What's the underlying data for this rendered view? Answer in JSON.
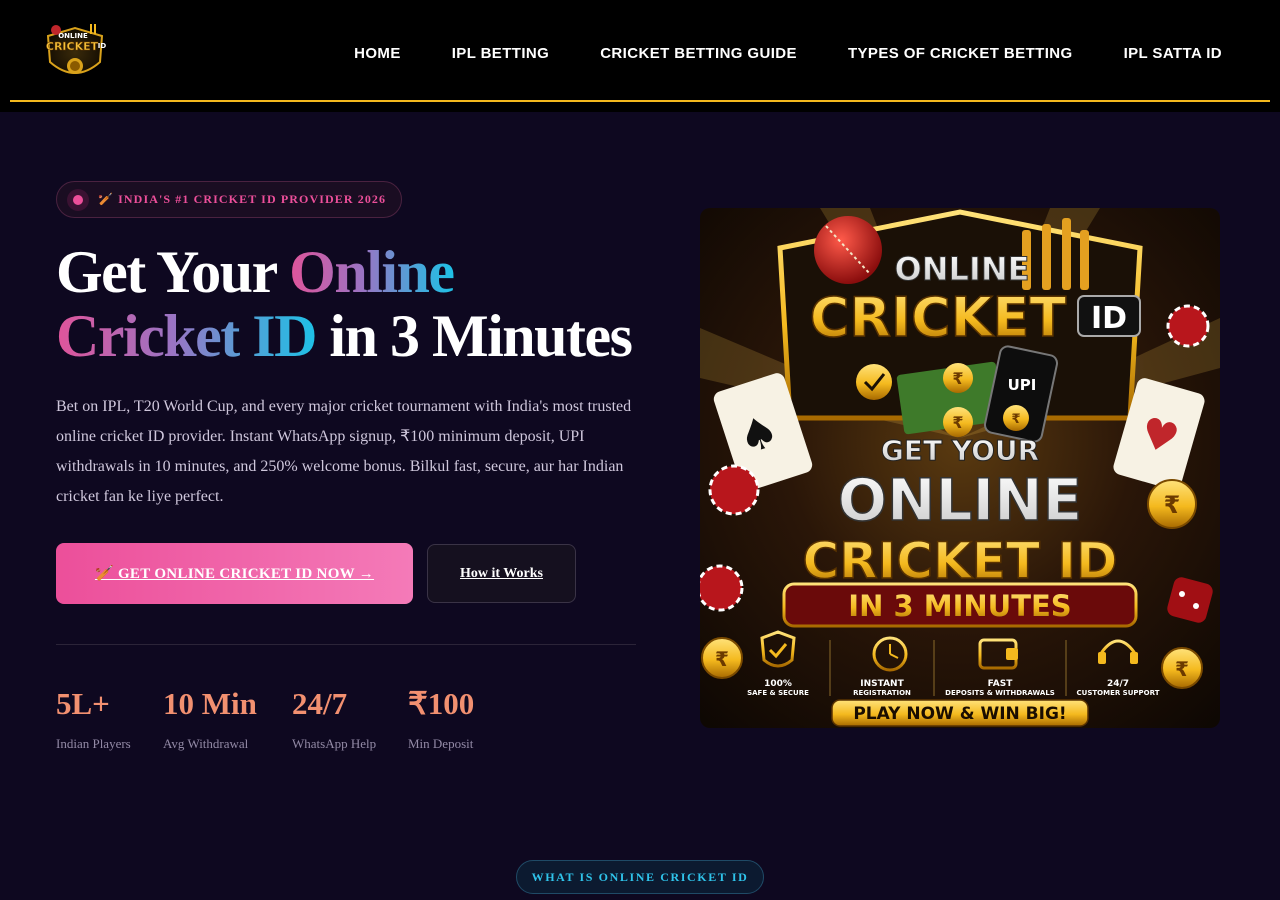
{
  "header": {
    "logo": {
      "line1": "ONLINE",
      "line2": "CRICKET",
      "line3": "ID"
    },
    "nav": [
      {
        "label": "HOME"
      },
      {
        "label": "IPL BETTING"
      },
      {
        "label": "CRICKET BETTING GUIDE"
      },
      {
        "label": "TYPES OF CRICKET BETTING"
      },
      {
        "label": "IPL SATTA ID"
      }
    ]
  },
  "hero": {
    "badge": "🏏 INDIA'S #1 CRICKET ID PROVIDER 2026",
    "headline": {
      "part1": "Get Your ",
      "grad1": "Online",
      "grad2": "Cricket ID",
      "part2": " in 3 Minutes"
    },
    "description": "Bet on IPL, T20 World Cup, and every major cricket tournament with India's most trusted online cricket ID provider. Instant WhatsApp signup, ₹100 minimum deposit, UPI withdrawals in 10 minutes, and 250% welcome bonus. Bilkul fast, secure, aur har Indian cricket fan ke liye perfect.",
    "primary_cta": "🏏 GET ONLINE CRICKET ID NOW →",
    "secondary_cta": "How it Works",
    "stats": [
      {
        "value": "5L+",
        "label": "Indian Players"
      },
      {
        "value": "10 Min",
        "label": "Avg Withdrawal"
      },
      {
        "value": "24/7",
        "label": "WhatsApp Help"
      },
      {
        "value": "₹100",
        "label": "Min Deposit"
      }
    ]
  },
  "promo_image": {
    "brand_line1": "ONLINE",
    "brand_line2": "CRICKET",
    "brand_line3": "ID",
    "upi": "UPI",
    "headline1": "GET YOUR",
    "headline2": "ONLINE",
    "headline3": "CRICKET ID",
    "headline4": "IN 3 MINUTES",
    "features": [
      {
        "title": "100%",
        "subtitle": "SAFE & SECURE",
        "icon": "shield-check-icon"
      },
      {
        "title": "INSTANT",
        "subtitle": "REGISTRATION",
        "icon": "stopwatch-icon"
      },
      {
        "title": "FAST",
        "subtitle": "DEPOSITS & WITHDRAWALS",
        "icon": "wallet-icon"
      },
      {
        "title": "24/7",
        "subtitle": "CUSTOMER SUPPORT",
        "icon": "headset-icon"
      }
    ],
    "cta": "PLAY NOW & WIN BIG!"
  },
  "next_section": {
    "pill": "WHAT IS ONLINE CRICKET ID"
  },
  "colors": {
    "accent_gold": "#f4b91e",
    "accent_pink": "#ec4f9a",
    "accent_cyan": "#1ec1e6",
    "stat_orange": "#f29070",
    "page_bg": "#0e0820"
  }
}
